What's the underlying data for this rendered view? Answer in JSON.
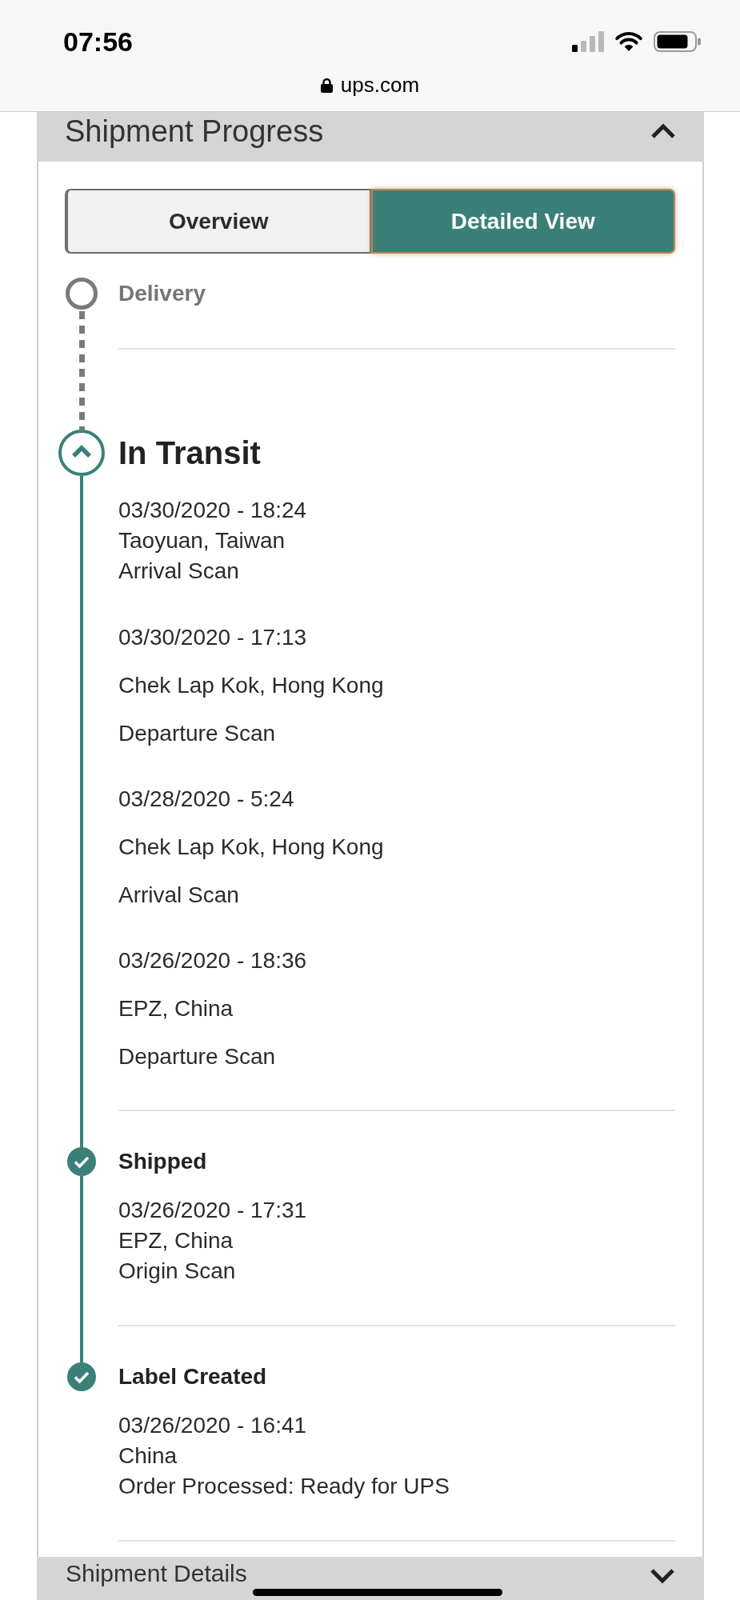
{
  "status_bar": {
    "time": "07:56"
  },
  "browser": {
    "url": "ups.com"
  },
  "shipment_progress": {
    "title": "Shipment Progress",
    "expanded": true,
    "view_tabs": [
      {
        "label": "Overview",
        "selected": false
      },
      {
        "label": "Detailed View",
        "selected": true
      }
    ],
    "milestones": [
      {
        "kind": "upcoming",
        "label": "Delivery"
      },
      {
        "kind": "current",
        "label": "In Transit",
        "events": [
          {
            "date": "03/30/2020 - 18:24",
            "location": "Taoyuan, Taiwan",
            "activity": "Arrival Scan"
          },
          {
            "date": "03/30/2020 - 17:13",
            "location": "Chek Lap Kok, Hong Kong",
            "activity": "Departure Scan"
          },
          {
            "date": "03/28/2020 - 5:24",
            "location": "Chek Lap Kok, Hong Kong",
            "activity": "Arrival Scan"
          },
          {
            "date": "03/26/2020 - 18:36",
            "location": "EPZ, China",
            "activity": "Departure Scan"
          }
        ]
      },
      {
        "kind": "completed",
        "label": "Shipped",
        "events": [
          {
            "date": "03/26/2020 - 17:31",
            "location": "EPZ, China",
            "activity": "Origin Scan"
          }
        ]
      },
      {
        "kind": "completed",
        "label": "Label Created",
        "events": [
          {
            "date": "03/26/2020 - 16:41",
            "location": "China",
            "activity": "Order Processed: Ready for UPS"
          }
        ]
      }
    ]
  },
  "shipment_details": {
    "title": "Shipment Details",
    "expanded": false
  }
}
